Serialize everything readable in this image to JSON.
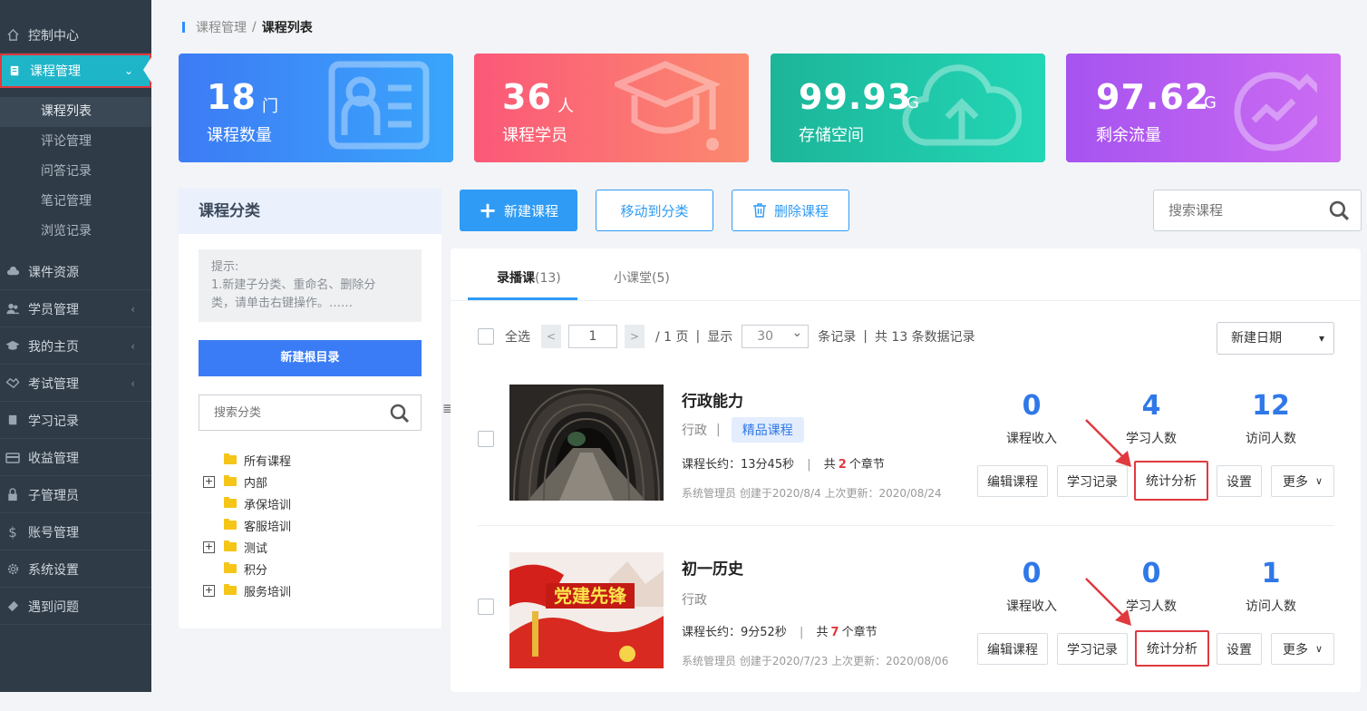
{
  "sidebar": {
    "items": [
      {
        "label": "控制中心",
        "icon": "home-icon"
      },
      {
        "label": "课程管理",
        "icon": "book-icon"
      },
      {
        "label": "课件资源",
        "icon": "cloud-icon"
      },
      {
        "label": "学员管理",
        "icon": "users-icon"
      },
      {
        "label": "我的主页",
        "icon": "graduation-icon"
      },
      {
        "label": "考试管理",
        "icon": "handshake-icon"
      },
      {
        "label": "学习记录",
        "icon": "notebook-icon"
      },
      {
        "label": "收益管理",
        "icon": "card-icon"
      },
      {
        "label": "子管理员",
        "icon": "lock-icon"
      },
      {
        "label": "账号管理",
        "icon": "dollar-icon"
      },
      {
        "label": "系统设置",
        "icon": "gear-icon"
      },
      {
        "label": "遇到问题",
        "icon": "ticket-icon"
      }
    ],
    "sub_items": [
      "课程列表",
      "评论管理",
      "问答记录",
      "笔记管理",
      "浏览记录"
    ]
  },
  "breadcrumb": {
    "parent": "课程管理",
    "sep": "/",
    "current": "课程列表"
  },
  "stats": [
    {
      "value": "18",
      "unit": "门",
      "label": "课程数量",
      "color_from": "#3d7bf5",
      "color_to": "#3aa5fb"
    },
    {
      "value": "36",
      "unit": "人",
      "label": "课程学员",
      "color_from": "#fb5878",
      "color_to": "#fb8a6f"
    },
    {
      "value": "99.93",
      "unit": "G",
      "label": "存储空间",
      "color_from": "#1db59a",
      "color_to": "#22d6b5"
    },
    {
      "value": "97.62",
      "unit": "G",
      "label": "剩余流量",
      "color_from": "#a653f0",
      "color_to": "#cc6cf2"
    }
  ],
  "category": {
    "title": "课程分类",
    "tip_lines": [
      "提示:",
      "1.新建子分类、重命名、删除分",
      "类，请单击右键操作。……"
    ],
    "new_root_label": "新建根目录",
    "search_placeholder": "搜索分类",
    "tree": [
      {
        "label": "所有课程",
        "expandable": false
      },
      {
        "label": "内部",
        "expandable": true
      },
      {
        "label": "承保培训",
        "expandable": false
      },
      {
        "label": "客服培训",
        "expandable": false
      },
      {
        "label": "测试",
        "expandable": true
      },
      {
        "label": "积分",
        "expandable": false
      },
      {
        "label": "服务培训",
        "expandable": true
      }
    ]
  },
  "toolbar": {
    "new_course": "新建课程",
    "move_to": "移动到分类",
    "delete": "删除课程",
    "search_placeholder": "搜索课程"
  },
  "tabs": [
    {
      "label": "录播课",
      "count": "(13)"
    },
    {
      "label": "小课堂",
      "count": "(5)"
    }
  ],
  "pager": {
    "select_all": "全选",
    "prev": "<",
    "page": "1",
    "next": ">",
    "total_pages": "/ 1 页",
    "sep": "|",
    "show": "显示",
    "page_size": "30",
    "records": "条记录",
    "total": "共 13 条数据记录",
    "sort": "新建日期"
  },
  "courses": [
    {
      "title": "行政能力",
      "category": "行政",
      "badge": "精品课程",
      "duration_prefix": "课程长约：13分45秒",
      "chapters_prefix": "共",
      "chapters": "2",
      "chapters_suffix": "个章节",
      "meta": "系统管理员 创建于2020/8/4 上次更新：2020/08/24",
      "income": "0",
      "income_label": "课程收入",
      "learners": "4",
      "learners_label": "学习人数",
      "visitors": "12",
      "visitors_label": "访问人数",
      "actions": {
        "edit": "编辑课程",
        "records": "学习记录",
        "stats": "统计分析",
        "settings": "设置",
        "more": "更多"
      }
    },
    {
      "title": "初一历史",
      "category": "行政",
      "badge": "",
      "duration_prefix": "课程长约：9分52秒",
      "chapters_prefix": "共",
      "chapters": "7",
      "chapters_suffix": "个章节",
      "meta": "系统管理员 创建于2020/7/23 上次更新：2020/08/06",
      "banner_text": "党建先锋",
      "income": "0",
      "income_label": "课程收入",
      "learners": "0",
      "learners_label": "学习人数",
      "visitors": "1",
      "visitors_label": "访问人数",
      "actions": {
        "edit": "编辑课程",
        "records": "学习记录",
        "stats": "统计分析",
        "settings": "设置",
        "more": "更多"
      }
    }
  ]
}
